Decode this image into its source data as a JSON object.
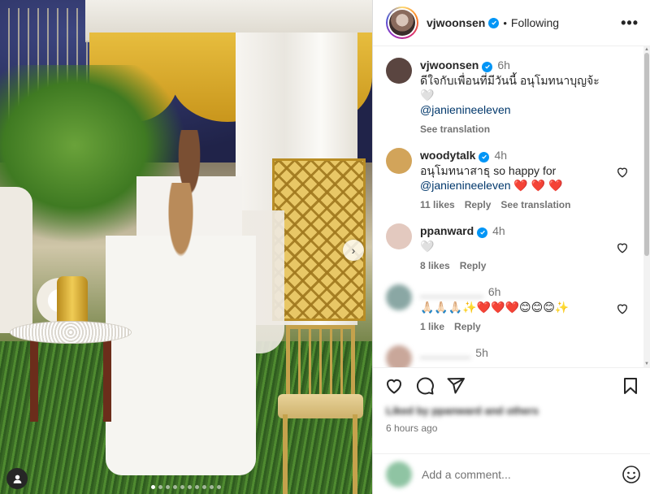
{
  "post": {
    "author": "vjwoonsen",
    "follow_status": "Following",
    "more_label": "•••",
    "carousel_total": 10,
    "carousel_active": 0,
    "next_label": "›"
  },
  "comments": [
    {
      "username": "vjwoonsen",
      "verified": true,
      "time": "6h",
      "text": "ดีใจกับเพื่อนที่มีวันนี้ อนุโมทนาบุญจ้ะ 🤍",
      "mention": "@janienineeleven",
      "meta": [
        "See translation"
      ],
      "heart": false,
      "avatar_color": "#5a4540",
      "blurred": false
    },
    {
      "username": "woodytalk",
      "verified": true,
      "time": "4h",
      "text": "อนุโมทนาสาธุ so happy for",
      "mention": "@janienineeleven",
      "text_after": " ❤️ ❤️ ❤️",
      "meta": [
        "11 likes",
        "Reply",
        "See translation"
      ],
      "heart": true,
      "avatar_color": "#d2a45a",
      "blurred": false
    },
    {
      "username": "ppanward",
      "verified": true,
      "time": "4h",
      "text": "🤍",
      "mention": "",
      "meta": [
        "8 likes",
        "Reply"
      ],
      "heart": true,
      "avatar_color": "#e3c9bf",
      "blurred": false
    },
    {
      "username": "__________",
      "verified": false,
      "time": "6h",
      "text": "🙏🏻🙏🏻🙏🏻✨❤️❤️❤️😊😊😊✨",
      "mention": "",
      "meta": [
        "1 like",
        "Reply"
      ],
      "heart": true,
      "avatar_color": "#8aa7a4",
      "blurred": true
    },
    {
      "username": "________",
      "verified": false,
      "time": "5h",
      "text": "",
      "mention": "",
      "meta": [],
      "heart": false,
      "avatar_color": "#c9a79a",
      "blurred": true
    }
  ],
  "actions": {
    "like_icon": "heart-icon",
    "comment_icon": "comment-icon",
    "share_icon": "share-icon",
    "save_icon": "bookmark-icon"
  },
  "liked_by": "Liked by ppanward and others",
  "timestamp": "6 hours ago",
  "add_comment": {
    "placeholder": "Add a comment...",
    "emoji_icon": "smiley-icon"
  }
}
